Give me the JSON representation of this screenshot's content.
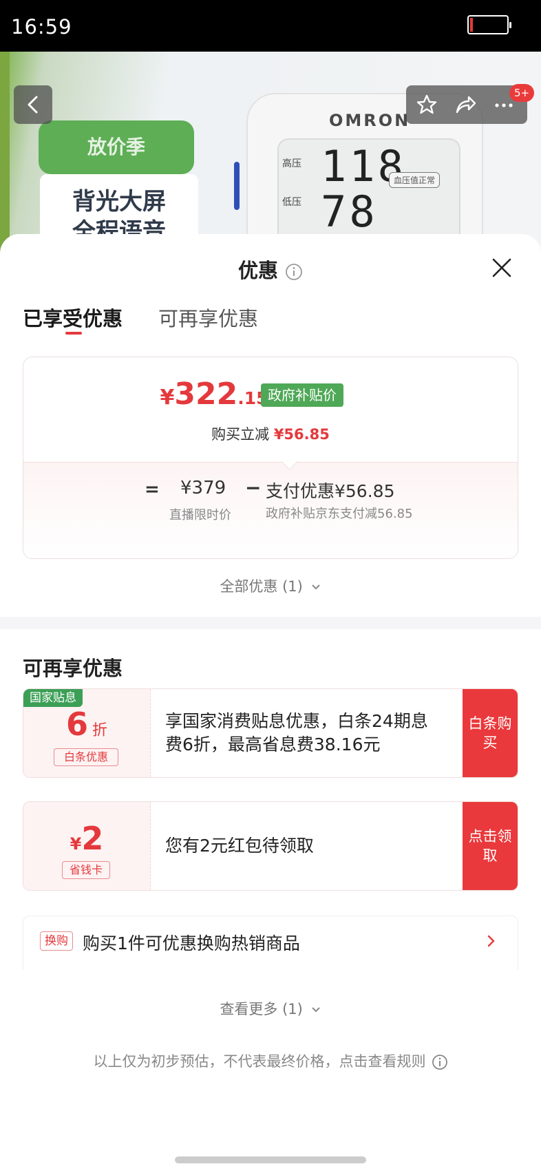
{
  "status_bar": {
    "time": "16:59"
  },
  "hero": {
    "badge": "放价季",
    "promo_line1": "背光大屏",
    "promo_line2": "全程语音",
    "brand": "OMRON",
    "label_high": "高压",
    "label_low": "低压",
    "reading_high": "118",
    "reading_low": "78",
    "status_tag": "血压值正常",
    "cart_badge": "5+"
  },
  "sheet": {
    "title": "优惠",
    "tabs": [
      "已享受优惠",
      "可再享优惠"
    ],
    "active_tab": "已享受优惠"
  },
  "applied": {
    "currency": "¥",
    "price_main": "322",
    "price_decimal": ".15",
    "gov_tag": "政府补贴价",
    "cut_label": "购买立减",
    "cut_amount": "¥56.85",
    "equals": "=",
    "original_price": "¥379",
    "original_label": "直播限时价",
    "minus": "−",
    "pay_discount": "支付优惠¥56.85",
    "pay_discount_label": "政府补贴京东支付减56.85",
    "all_promotions": "全部优惠 (1)"
  },
  "more_offers": {
    "title": "可再享优惠",
    "offers": [
      {
        "corner_tag": "国家贴息",
        "big": "6",
        "unit": "折",
        "sub_tag": "白条优惠",
        "description": "享国家消费贴息优惠，白条24期息费6折，最高省息费38.16元",
        "action": "白条购买"
      },
      {
        "currency": "¥",
        "big": "2",
        "sub_tag": "省钱卡",
        "description": "您有2元红包待领取",
        "action": "点击领取"
      }
    ],
    "swap": {
      "tag": "换购",
      "text": "购买1件可优惠换购热销商品"
    },
    "see_more": "查看更多 (1)"
  },
  "footer_note": "以上仅为初步预估，不代表最终价格，点击查看规则",
  "colors": {
    "accent_red": "#e4393c",
    "gov_green": "#4fa857",
    "action_red": "#e9393c"
  },
  "icons": [
    "back-arrow-icon",
    "star-icon",
    "share-icon",
    "more-dots-icon",
    "info-icon",
    "close-icon",
    "chevron-down-icon",
    "chevron-right-icon",
    "battery-icon"
  ]
}
